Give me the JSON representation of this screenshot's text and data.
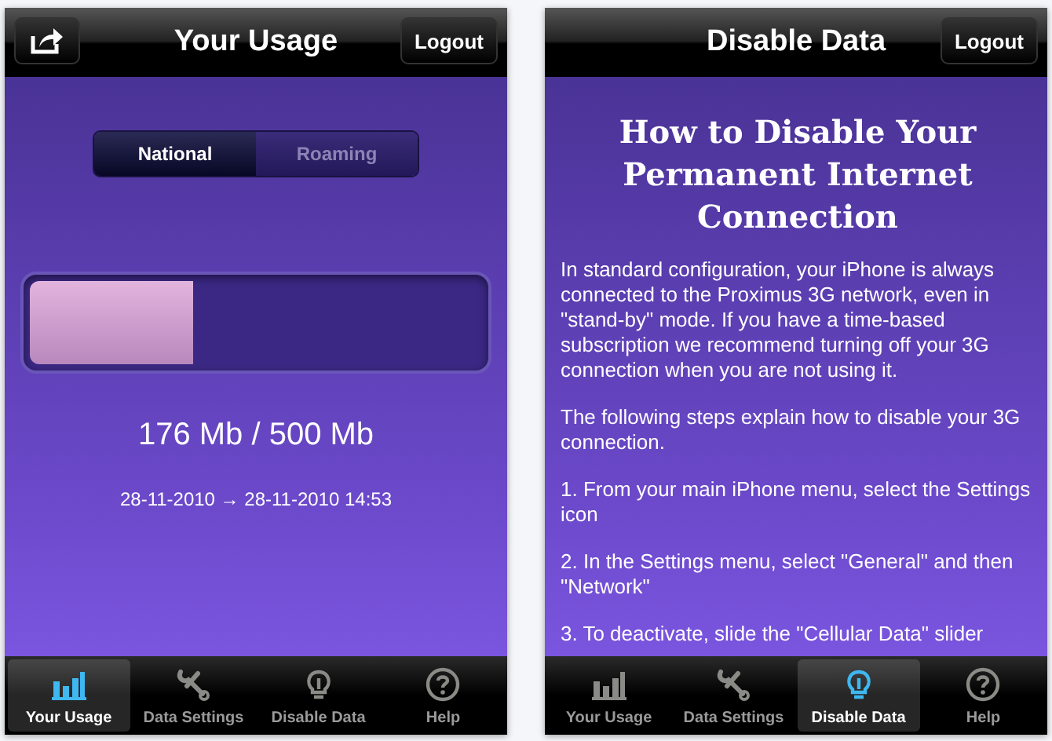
{
  "screens": [
    {
      "kind": "usage",
      "title": "Your Usage",
      "share_button": true,
      "logout": "Logout",
      "segments": [
        {
          "label": "National",
          "selected": true
        },
        {
          "label": "Roaming",
          "selected": false
        }
      ],
      "level": 0.36,
      "reading": "176 Mb / 500 Mb",
      "period": "28-11-2010 → 28-11-2010 14:53",
      "tabs": [
        {
          "label": "Your Usage",
          "selected": true
        },
        {
          "label": "Data Settings",
          "selected": false
        },
        {
          "label": "Disable Data",
          "selected": false
        },
        {
          "label": "Help",
          "selected": false
        }
      ]
    },
    {
      "kind": "article",
      "title": "Disable Data",
      "share_button": false,
      "logout": "Logout",
      "heading": "How to Disable Your Permanent Internet Connection",
      "paragraphs": [
        "In standard configuration, your iPhone is always connected to the Proximus 3G network, even in \"stand-by\" mode. If you have a time-based subscription we recommend turning off your 3G connection when you are not using it.",
        "The following steps explain how to disable your 3G connection.",
        "1. From your main iPhone menu, select the Settings icon",
        "2. In the Settings menu, select \"General\" and then \"Network\"",
        "3. To deactivate, slide the \"Cellular Data\" slider"
      ],
      "tabs": [
        {
          "label": "Your Usage",
          "selected": false
        },
        {
          "label": "Data Settings",
          "selected": false
        },
        {
          "label": "Disable Data",
          "selected": true
        },
        {
          "label": "Help",
          "selected": false
        }
      ]
    }
  ]
}
